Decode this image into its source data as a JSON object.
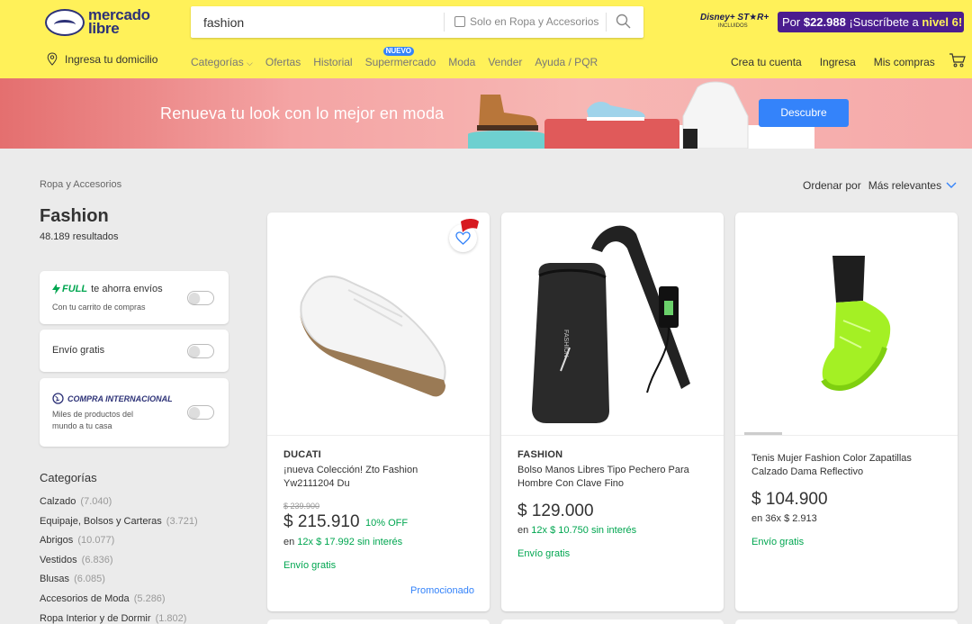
{
  "header": {
    "logo_icon": "handshake-icon",
    "logo_line1": "mercado",
    "logo_line2": "libre",
    "search_value": "fashion",
    "search_filter_label": "Solo en Ropa y Accesorios",
    "search_icon": "search-icon",
    "disney_logo": "Disney+ ST★R+",
    "disney_sub": "INCLUIDOS",
    "subscribe_prefix": "Por ",
    "subscribe_price": "$22.988",
    "subscribe_text": " ¡Suscríbete a ",
    "subscribe_level": "nivel 6!",
    "location_icon": "location-pin-icon",
    "location_label": "Ingresa tu domicilio",
    "nav": [
      "Categorías",
      "Ofertas",
      "Historial",
      "Supermercado",
      "Moda",
      "Vender",
      "Ayuda / PQR"
    ],
    "nuevo_badge": "NUEVO",
    "user_nav": [
      "Crea tu cuenta",
      "Ingresa",
      "Mis compras"
    ],
    "cart_icon": "cart-icon"
  },
  "banner": {
    "text": "Renueva tu look con lo mejor en moda",
    "button": "Descubre"
  },
  "breadcrumb": "Ropa y Accesorios",
  "sort": {
    "label": "Ordenar por",
    "value": "Más relevantes"
  },
  "search_title": "Fashion",
  "results": "48.189 resultados",
  "filters": {
    "full_brand": "FULL",
    "full_title": "te ahorra envíos",
    "full_sub": "Con tu carrito de compras",
    "free_shipping": "Envío gratis",
    "intl_title": "COMPRA INTERNACIONAL",
    "intl_sub_line1": "Miles de productos del",
    "intl_sub_line2": "mundo a tu casa"
  },
  "categories_heading": "Categorías",
  "categories": [
    {
      "name": "Calzado",
      "count": "(7.040)"
    },
    {
      "name": "Equipaje, Bolsos y Carteras",
      "count": "(3.721)"
    },
    {
      "name": "Abrigos",
      "count": "(10.077)"
    },
    {
      "name": "Vestidos",
      "count": "(6.836)"
    },
    {
      "name": "Blusas",
      "count": "(6.085)"
    },
    {
      "name": "Accesorios de Moda",
      "count": "(5.286)"
    },
    {
      "name": "Ropa Interior y de Dormir",
      "count": "(1.802)"
    }
  ],
  "products": [
    {
      "brand": "DUCATI",
      "title_line1": "¡nueva Colección! Zto Fashion",
      "title_line2": "Yw2111204 Du",
      "old_price": "$ 239.900",
      "price": "$ 215.910",
      "discount": "10% OFF",
      "installments_prefix": "en ",
      "installments": "12x $ 17.992 sin interés",
      "shipping": "Envío gratis",
      "promoted": "Promocionado"
    },
    {
      "brand": "FASHION",
      "title_line1": "Bolso Manos Libres Tipo Pechero Para",
      "title_line2": "Hombre Con Clave Fino",
      "price": "$ 129.000",
      "installments_prefix": "en ",
      "installments": "12x $ 10.750 sin interés",
      "shipping": "Envío gratis"
    },
    {
      "title_line1": "Tenis Mujer Fashion Color Zapatillas",
      "title_line2": "Calzado Dama Reflectivo",
      "price": "$ 104.900",
      "installments": "en 36x $ 2.913",
      "shipping": "Envío gratis"
    }
  ],
  "colors": {
    "header_yellow": "#fff159",
    "brand_blue": "#3483fa",
    "green": "#00a650",
    "subscribe_purple": "#4b1d8f"
  }
}
